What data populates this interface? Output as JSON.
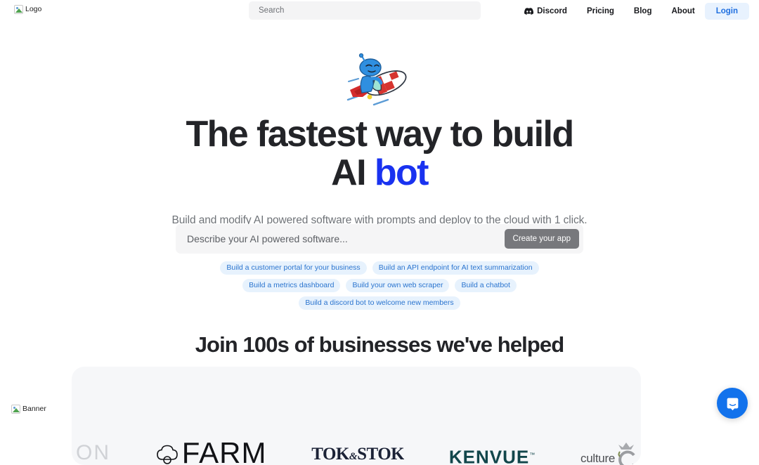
{
  "header": {
    "logo_alt": "Logo",
    "logo_icon": "broken-image-icon",
    "search": {
      "placeholder": "Search",
      "value": ""
    },
    "nav": [
      {
        "label": "Discord",
        "icon": "discord-icon",
        "name": "discord"
      },
      {
        "label": "Pricing",
        "icon": "",
        "name": "pricing"
      },
      {
        "label": "Blog",
        "icon": "",
        "name": "blog"
      },
      {
        "label": "About",
        "icon": "",
        "name": "about"
      }
    ],
    "login_label": "Login"
  },
  "hero": {
    "mascot_icon": "robot-on-rocket-illustration",
    "headline_line1": "The fastest way to build",
    "headline_line2_prefix": "AI",
    "headline_line2_accent": "bot",
    "subtitle": "Build and modify AI powered software with prompts and deploy to the cloud with 1 click.",
    "prompt": {
      "placeholder": "Describe your AI powered software...",
      "value": "",
      "button_label": "Create your app"
    },
    "suggestions": [
      "Build a customer portal for your business",
      "Build an API endpoint for AI text summarization",
      "Build a metrics dashboard",
      "Build your own web scraper",
      "Build a chatbot",
      "Build a discord bot to welcome new members"
    ]
  },
  "social_proof": {
    "title": "Join 100s of businesses we've helped",
    "banner_alt": "Banner",
    "banner_icon": "broken-image-icon",
    "brands": [
      {
        "name": "on",
        "label": "ON"
      },
      {
        "name": "farm",
        "label": "FARM"
      },
      {
        "name": "tok-e-stok",
        "label_a": "TOK",
        "label_amp": "&",
        "label_b": "STOK"
      },
      {
        "name": "kenvue",
        "label": "KENVUE",
        "tm": "™"
      },
      {
        "name": "culture",
        "label": "culture"
      }
    ]
  },
  "chat_widget": {
    "icon": "chat-bubble-icon",
    "color": "#1272ec"
  },
  "colors": {
    "accent_blue": "#1932f0",
    "link_blue": "#1f6fe0",
    "chip_bg": "#e7f2fd",
    "chip_text": "#2a74cf",
    "button_gray": "#77787c",
    "card_bg": "#f6f7f9"
  }
}
